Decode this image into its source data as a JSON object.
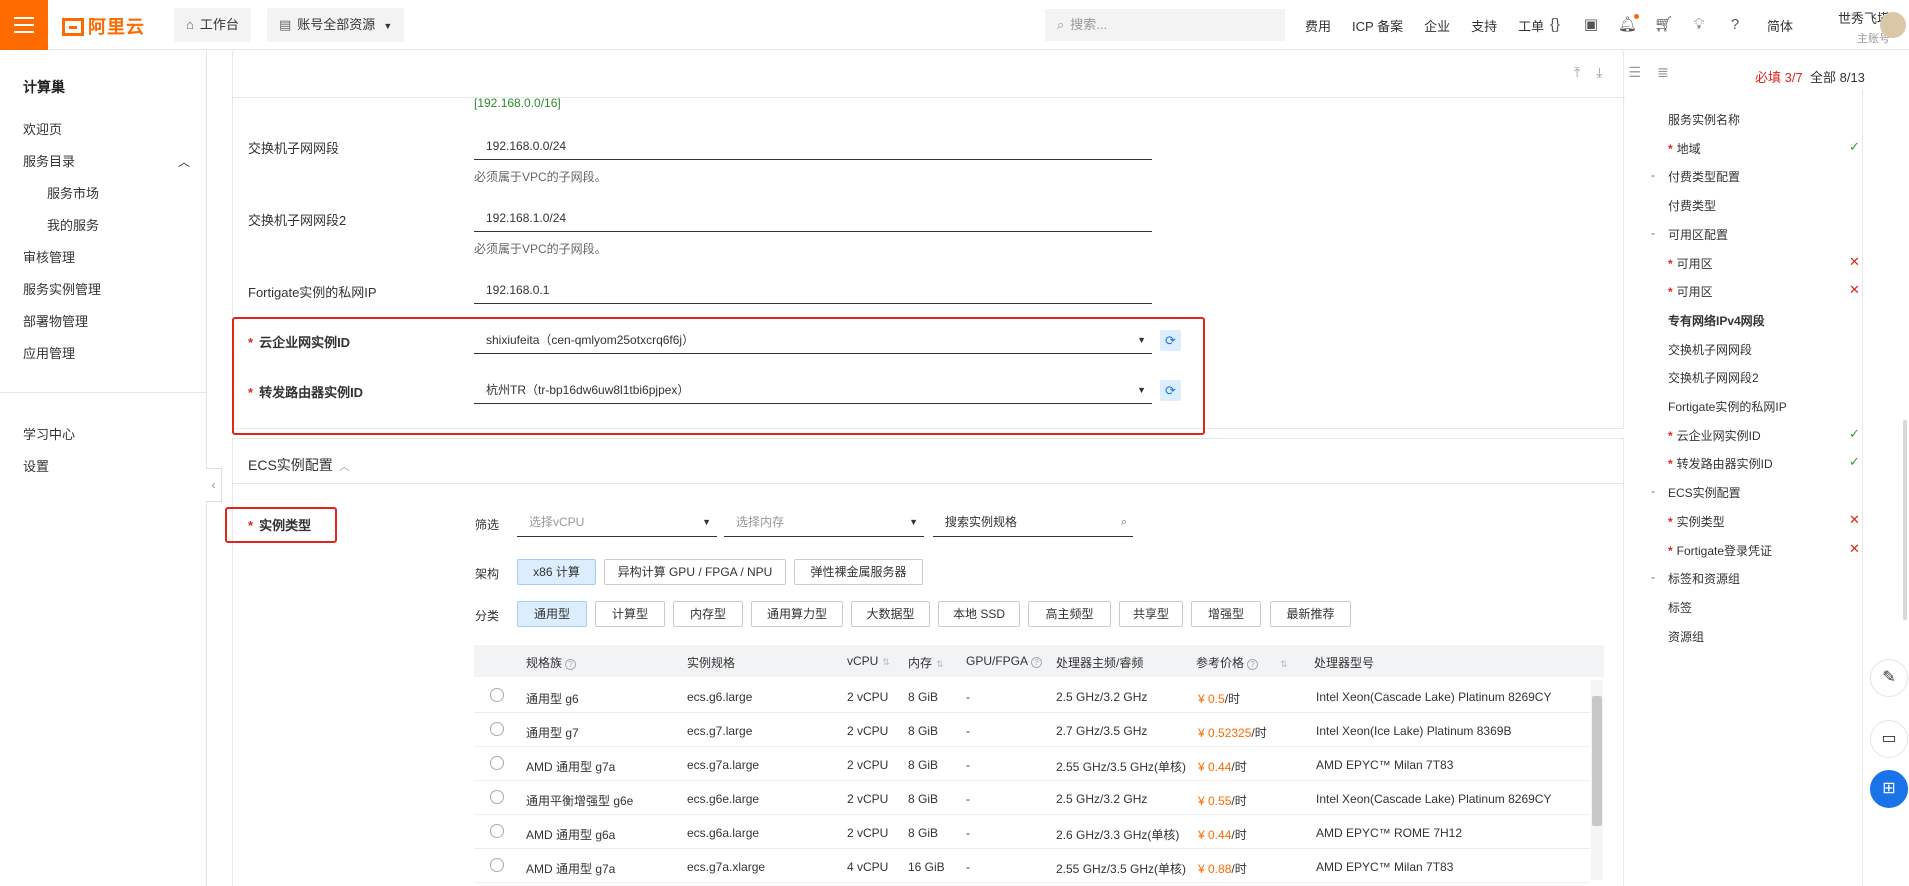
{
  "topbar": {
    "logo_text": "阿里云",
    "workbench": "工作台",
    "account_resources": "账号全部资源",
    "search_placeholder": "搜索...",
    "links": [
      "费用",
      "ICP 备案",
      "企业",
      "支持",
      "工单"
    ],
    "icons": [
      "code-icon",
      "terminal-icon",
      "bell-icon",
      "cart-icon",
      "bulb-icon",
      "help-icon"
    ],
    "language": "简体",
    "user_name": "世秀飞塔",
    "user_role": "主账号"
  },
  "sidebar": {
    "title": "计算巢",
    "items": [
      "欢迎页",
      "服务目录",
      "服务市场",
      "我的服务",
      "审核管理",
      "服务实例管理",
      "部署物管理",
      "应用管理"
    ],
    "bottom_items": [
      "学习中心",
      "设置"
    ]
  },
  "toolbar": {
    "required_count": "必填 3/7",
    "all_count": "全部 8/13"
  },
  "network": {
    "vpc_cidr_hint": "[192.168.0.0/16]",
    "switch_subnet_label": "交换机子网网段",
    "switch_subnet_value": "192.168.0.0/24",
    "switch_subnet_hint": "必须属于VPC的子网段。",
    "switch_subnet2_label": "交换机子网网段2",
    "switch_subnet2_value": "192.168.1.0/24",
    "switch_subnet2_hint": "必须属于VPC的子网段。",
    "fortigate_ip_label": "Fortigate实例的私网IP",
    "fortigate_ip_value": "192.168.0.1",
    "cen_label": "云企业网实例ID",
    "cen_value": "shixiufeita（cen-qmlyom25otxcrq6f6j）",
    "tr_label": "转发路由器实例ID",
    "tr_value": "杭州TR（tr-bp16dw6uw8l1tbi6pjpex）"
  },
  "ecs": {
    "section_title": "ECS实例配置",
    "instance_type_label": "实例类型",
    "filter_label": "筛选",
    "vcpu_placeholder": "选择vCPU",
    "memory_placeholder": "选择内存",
    "spec_search_placeholder": "搜索实例规格",
    "arch_label": "架构",
    "arch_options": [
      "x86 计算",
      "异构计算 GPU / FPGA / NPU",
      "弹性裸金属服务器"
    ],
    "category_label": "分类",
    "category_options": [
      "通用型",
      "计算型",
      "内存型",
      "通用算力型",
      "大数据型",
      "本地 SSD",
      "高主频型",
      "共享型",
      "增强型",
      "最新推荐"
    ],
    "columns": [
      "规格族",
      "实例规格",
      "vCPU",
      "内存",
      "GPU/FPGA",
      "处理器主频/睿频",
      "参考价格",
      "处理器型号"
    ],
    "rows": [
      {
        "family": "通用型 g6",
        "spec": "ecs.g6.large",
        "vcpu": "2 vCPU",
        "mem": "8 GiB",
        "gpu": "-",
        "freq": "2.5 GHz/3.2 GHz",
        "price": "¥ 0.5",
        "unit": "/时",
        "cpu": "Intel Xeon(Cascade Lake) Platinum 8269CY"
      },
      {
        "family": "通用型 g7",
        "spec": "ecs.g7.large",
        "vcpu": "2 vCPU",
        "mem": "8 GiB",
        "gpu": "-",
        "freq": "2.7 GHz/3.5 GHz",
        "price": "¥ 0.52325",
        "unit": "/时",
        "cpu": "Intel Xeon(Ice Lake) Platinum 8369B"
      },
      {
        "family": "AMD 通用型 g7a",
        "spec": "ecs.g7a.large",
        "vcpu": "2 vCPU",
        "mem": "8 GiB",
        "gpu": "-",
        "freq": "2.55 GHz/3.5 GHz(单核)",
        "price": "¥ 0.44",
        "unit": "/时",
        "cpu": "AMD EPYC™ Milan 7T83"
      },
      {
        "family": "通用平衡增强型 g6e",
        "spec": "ecs.g6e.large",
        "vcpu": "2 vCPU",
        "mem": "8 GiB",
        "gpu": "-",
        "freq": "2.5 GHz/3.2 GHz",
        "price": "¥ 0.55",
        "unit": "/时",
        "cpu": "Intel Xeon(Cascade Lake) Platinum 8269CY"
      },
      {
        "family": "AMD 通用型 g6a",
        "spec": "ecs.g6a.large",
        "vcpu": "2 vCPU",
        "mem": "8 GiB",
        "gpu": "-",
        "freq": "2.6 GHz/3.3 GHz(单核)",
        "price": "¥ 0.44",
        "unit": "/时",
        "cpu": "AMD EPYC™ ROME 7H12"
      },
      {
        "family": "AMD 通用型 g7a",
        "spec": "ecs.g7a.xlarge",
        "vcpu": "4 vCPU",
        "mem": "16 GiB",
        "gpu": "-",
        "freq": "2.55 GHz/3.5 GHz(单核)",
        "price": "¥ 0.88",
        "unit": "/时",
        "cpu": "AMD EPYC™ Milan 7T83"
      }
    ]
  },
  "right_nav": [
    {
      "label": "服务实例名称",
      "required": false,
      "dash": false,
      "bold": false,
      "status": ""
    },
    {
      "label": "地域",
      "required": true,
      "dash": false,
      "bold": false,
      "status": "ok"
    },
    {
      "label": "付费类型配置",
      "required": false,
      "dash": true,
      "bold": false,
      "status": ""
    },
    {
      "label": "付费类型",
      "required": false,
      "dash": false,
      "bold": false,
      "status": ""
    },
    {
      "label": "可用区配置",
      "required": false,
      "dash": true,
      "bold": false,
      "status": ""
    },
    {
      "label": "可用区",
      "required": true,
      "dash": false,
      "bold": false,
      "status": "bad"
    },
    {
      "label": "可用区",
      "required": true,
      "dash": false,
      "bold": false,
      "status": "bad"
    },
    {
      "label": "专有网络IPv4网段",
      "required": false,
      "dash": false,
      "bold": true,
      "status": ""
    },
    {
      "label": "交换机子网网段",
      "required": false,
      "dash": false,
      "bold": false,
      "status": ""
    },
    {
      "label": "交换机子网网段2",
      "required": false,
      "dash": false,
      "bold": false,
      "status": ""
    },
    {
      "label": "Fortigate实例的私网IP",
      "required": false,
      "dash": false,
      "bold": false,
      "status": ""
    },
    {
      "label": "云企业网实例ID",
      "required": true,
      "dash": false,
      "bold": false,
      "status": "ok"
    },
    {
      "label": "转发路由器实例ID",
      "required": true,
      "dash": false,
      "bold": false,
      "status": "ok"
    },
    {
      "label": "ECS实例配置",
      "required": false,
      "dash": true,
      "bold": false,
      "status": ""
    },
    {
      "label": "实例类型",
      "required": true,
      "dash": false,
      "bold": false,
      "status": "bad"
    },
    {
      "label": "Fortigate登录凭证",
      "required": true,
      "dash": false,
      "bold": false,
      "status": "bad"
    },
    {
      "label": "标签和资源组",
      "required": false,
      "dash": true,
      "bold": false,
      "status": ""
    },
    {
      "label": "标签",
      "required": false,
      "dash": false,
      "bold": false,
      "status": ""
    },
    {
      "label": "资源组",
      "required": false,
      "dash": false,
      "bold": false,
      "status": ""
    }
  ],
  "colors": {
    "brand": "#ff6a00",
    "highlight_box": "#e1251b",
    "ok": "#2a9d3a",
    "error": "#e1251b",
    "active_tag": "#dceefe"
  }
}
